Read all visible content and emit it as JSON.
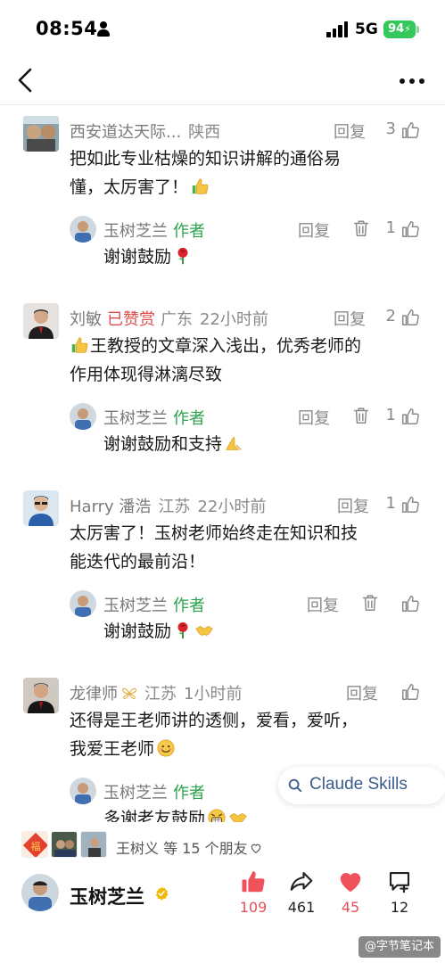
{
  "status_bar": {
    "time": "08:54",
    "network": "5G",
    "battery": "94"
  },
  "comments": [
    {
      "name": "西安道达天际...",
      "location": "陕西",
      "text_line1": "把如此专业枯燥的知识讲解的通俗易",
      "text_line2": "懂，太厉害了！",
      "reply_label": "回复",
      "likes": "3",
      "reply": {
        "name": "玉树芝兰",
        "author_tag": "作者",
        "text": "谢谢鼓励",
        "reply_label": "回复",
        "likes": "1"
      }
    },
    {
      "name": "刘敏",
      "badge": "已赞赏",
      "location": "广东",
      "time": "22小时前",
      "text_line1": "王教授的文章深入浅出，优秀老师的",
      "text_line2": "作用体现得淋漓尽致",
      "reply_label": "回复",
      "likes": "2",
      "reply": {
        "name": "玉树芝兰",
        "author_tag": "作者",
        "text": "谢谢鼓励和支持",
        "reply_label": "回复",
        "likes": "1"
      }
    },
    {
      "name": "Harry 潘浩",
      "location": "江苏",
      "time": "22小时前",
      "text_line1": "太厉害了！玉树老师始终走在知识和技",
      "text_line2": "能迭代的最前沿！",
      "reply_label": "回复",
      "likes": "1",
      "reply": {
        "name": "玉树芝兰",
        "author_tag": "作者",
        "text": "谢谢鼓励",
        "reply_label": "回复",
        "likes": ""
      }
    },
    {
      "name": "龙律师",
      "location": "江苏",
      "time": "1小时前",
      "text_line1": "还得是王老师讲的透侧，爱看，爱听，",
      "text_line2": "我爱王老师",
      "reply_label": "回复",
      "likes": "",
      "reply": {
        "name": "玉树芝兰",
        "author_tag": "作者",
        "text": "多谢老友鼓励"
      }
    }
  ],
  "search_pill": {
    "text": "Claude Skills"
  },
  "friends": {
    "text": "王树义 等 15 个朋友"
  },
  "author": {
    "name": "玉树芝兰"
  },
  "actions": {
    "likes": "109",
    "shares": "461",
    "favorites": "45",
    "comments": "12"
  },
  "watermark": "@字节笔记本",
  "colors": {
    "author_green": "#2ba24c",
    "red_badge": "#e14a4a",
    "heart_red": "#f0525c",
    "link_blue": "#3b5b8a"
  }
}
